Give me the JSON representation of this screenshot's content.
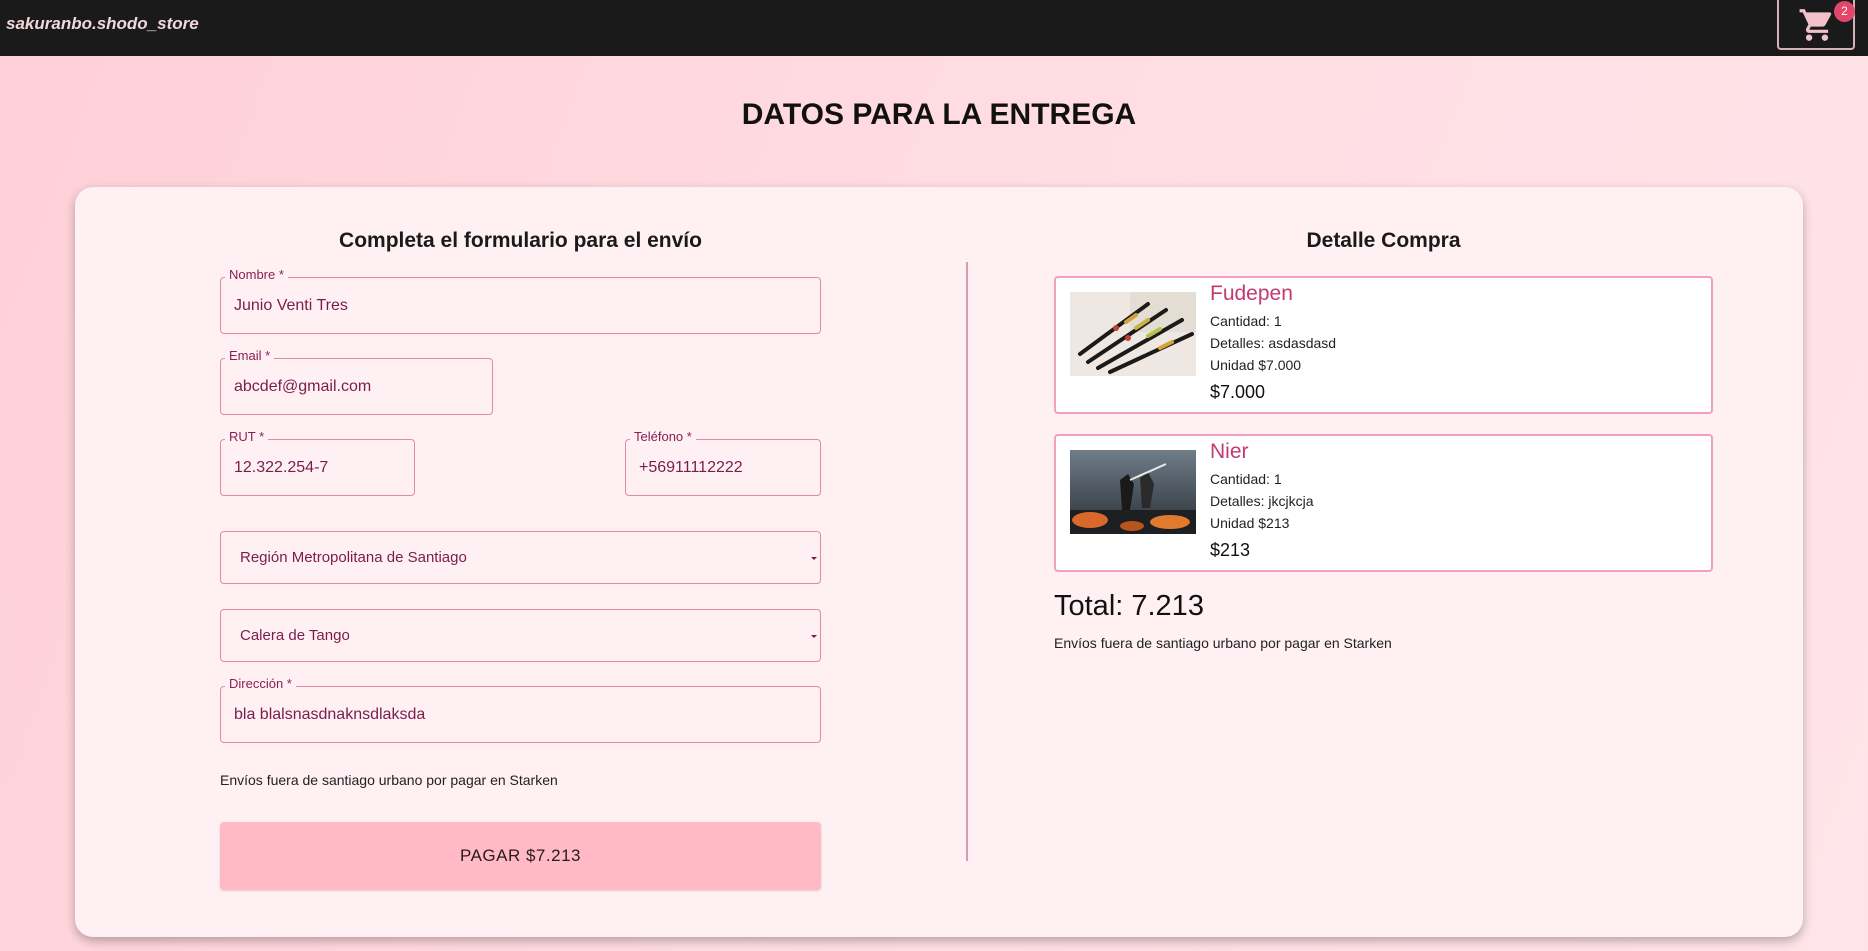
{
  "header": {
    "brand": "sakuranbo.shodo_store",
    "cart_count": "2",
    "cart_icon": "shopping-cart-icon"
  },
  "page": {
    "title": "DATOS PARA LA ENTREGA"
  },
  "form": {
    "title": "Completa el formulario para el envío",
    "nombre": {
      "label": "Nombre *",
      "value": "Junio Venti Tres"
    },
    "email": {
      "label": "Email *",
      "value": "abcdef@gmail.com"
    },
    "rut": {
      "label": "RUT *",
      "value": "12.322.254-7"
    },
    "telefono": {
      "label": "Teléfono *",
      "value": "+56911112222"
    },
    "region": {
      "value": "Región Metropolitana de Santiago"
    },
    "comuna": {
      "value": "Calera de Tango"
    },
    "direccion": {
      "label": "Dirección *",
      "value": "bla blalsnasdnaknsdlaksda"
    },
    "note": "Envíos fuera de santiago urbano por pagar en Starken",
    "pay_label": "PAGAR $7.213"
  },
  "summary": {
    "title": "Detalle Compra",
    "items": [
      {
        "name": "Fudepen",
        "cantidad": "Cantidad: 1",
        "detalles": "Detalles: asdasdasd",
        "unidad": "Unidad $7.000",
        "price": "$7.000"
      },
      {
        "name": "Nier",
        "cantidad": "Cantidad: 1",
        "detalles": "Detalles: jkcjkcja",
        "unidad": "Unidad $213",
        "price": "$213"
      }
    ],
    "total": "Total: 7.213",
    "note": "Envíos fuera de santiago urbano por pagar en Starken"
  },
  "colors": {
    "accent": "#c23a6f",
    "button": "#ffbac6",
    "badge": "#e0476a",
    "topbar": "#1b1a1a"
  }
}
